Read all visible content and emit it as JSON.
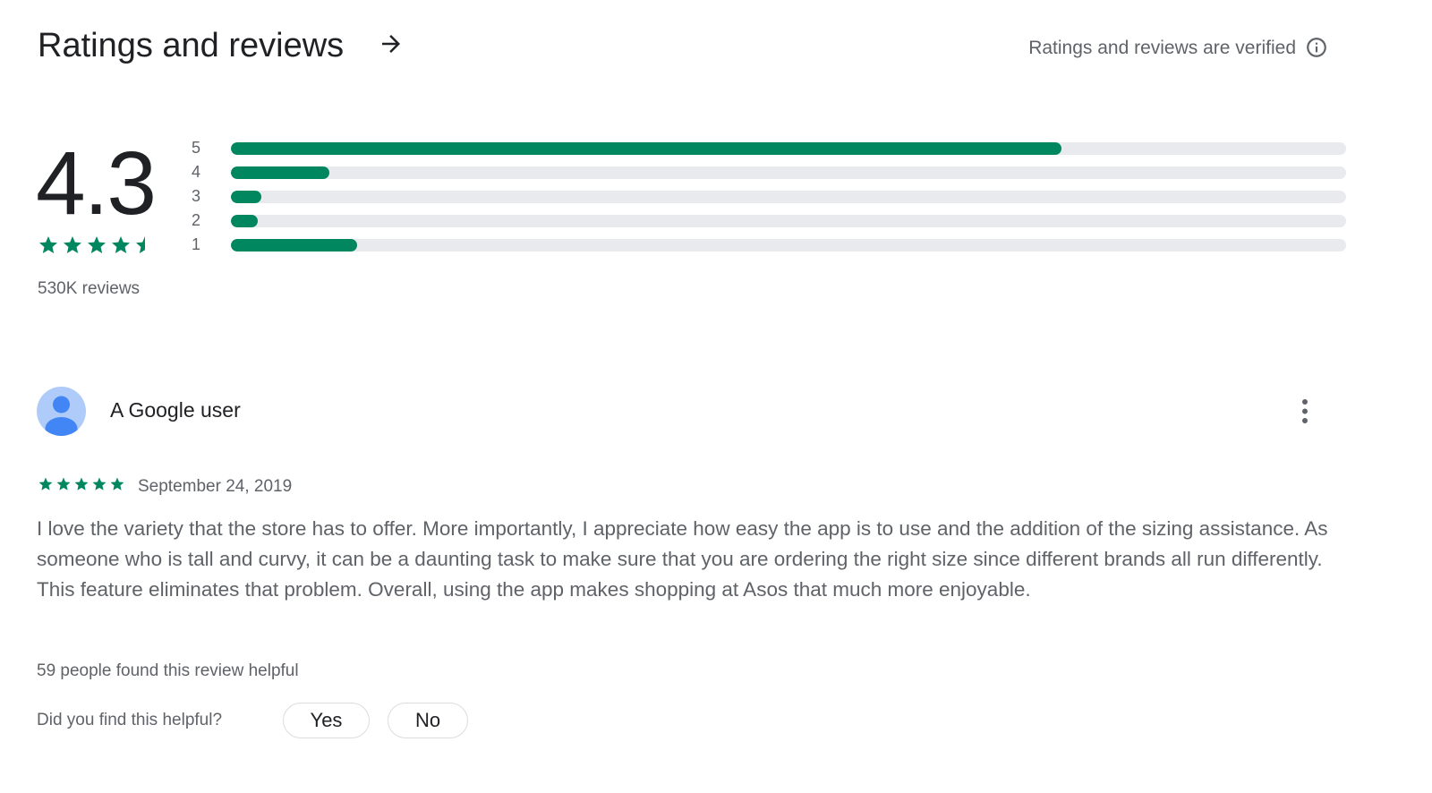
{
  "header": {
    "title": "Ratings and reviews",
    "verified_text": "Ratings and reviews are verified"
  },
  "summary": {
    "rating": "4.3",
    "stars": 4.5,
    "reviews_label": "530K reviews",
    "distribution": [
      {
        "label": "5",
        "fraction": 0.745
      },
      {
        "label": "4",
        "fraction": 0.088
      },
      {
        "label": "3",
        "fraction": 0.027
      },
      {
        "label": "2",
        "fraction": 0.024
      },
      {
        "label": "1",
        "fraction": 0.113
      }
    ]
  },
  "review": {
    "author": "A Google user",
    "stars": 5,
    "date": "September 24, 2019",
    "body": "I love the variety that the store has to offer. More importantly, I appreciate how easy the app is to use and the addition of the sizing assistance. As someone who is tall and curvy, it can be a daunting task to make sure that you are ordering the right size since different brands all run differently. This feature eliminates that problem. Overall, using the app makes shopping at Asos that much more enjoyable.",
    "helpful_count": "59 people found this review helpful",
    "helpful_question": "Did you find this helpful?",
    "yes_label": "Yes",
    "no_label": "No"
  },
  "colors": {
    "accent": "#01875f",
    "track": "#e8eaed",
    "avatar_bg": "#aecbfa",
    "avatar_fg": "#4285f4"
  },
  "icons": {
    "title_arrow": "arrow-right-icon",
    "info": "info-icon",
    "more": "more-vert-icon",
    "avatar": "person-icon",
    "star": "star-icon"
  }
}
